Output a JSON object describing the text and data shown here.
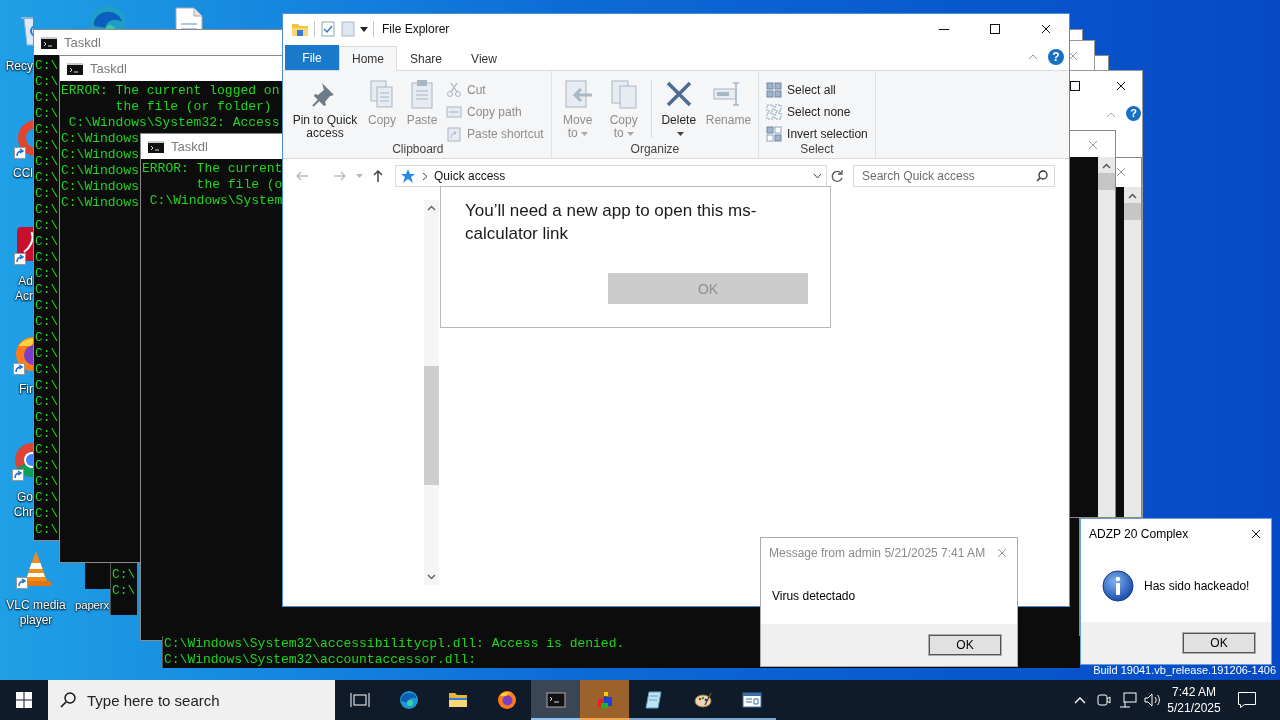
{
  "desktop_icons": [
    {
      "kind": "recycle-bin",
      "label": "Recy"
    },
    {
      "kind": "swirl"
    },
    {
      "kind": "document"
    },
    {
      "kind": "ring",
      "shortcut": true,
      "label": "CCl"
    },
    {
      "kind": "app-tile",
      "shortcut": true,
      "label": "Ad Acr"
    },
    {
      "kind": "flame-globe",
      "shortcut": true,
      "label": "Fir"
    },
    {
      "kind": "wheel",
      "shortcut": true,
      "label": "Go Chr"
    },
    {
      "kind": "cone",
      "shortcut": true,
      "label": "VLC media player"
    },
    {
      "label": "paperx"
    }
  ],
  "consoles": [
    {
      "title": "Taskdl",
      "lines": [
        "C:\\",
        "C:\\",
        "C:\\",
        "C:\\",
        "C:\\",
        "C:\\",
        "C:\\",
        "C:\\",
        "C:\\",
        "C:\\",
        "C:\\",
        "C:\\",
        "C:\\",
        "C:\\",
        "C:\\",
        "C:\\",
        "C:\\",
        "C:\\",
        "C:\\",
        "C:\\",
        "C:\\",
        "C:\\",
        "C:\\",
        "C:\\",
        "C:\\",
        "C:\\",
        "C:\\",
        "C:\\",
        "C:\\",
        "C:\\"
      ]
    },
    {
      "title": "Taskdl",
      "lines": [
        "ERROR: The current logged on",
        "       the file (or folder)",
        " C:\\Windows\\System32: Access",
        "C:\\Windows",
        "C:\\Windows",
        "C:\\Windows",
        "C:\\Windows",
        "C:\\Windows"
      ]
    },
    {
      "lines": [
        "C:\\",
        "C:\\"
      ]
    },
    {
      "title": "Taskdl",
      "lines": [
        "ERROR: The current",
        "       the file (o",
        " C:\\Windows\\System"
      ]
    },
    {
      "lines": [
        "C:\\Windows\\System32\\accessibilitycpl.dll: Access is denied.",
        "C:\\Windows\\System32\\accountaccessor.dll:"
      ]
    }
  ],
  "side_window": {
    "help": "?"
  },
  "explorer": {
    "title": "File Explorer",
    "help": "?",
    "tabs": [
      {
        "label": "File",
        "kind": "menu",
        "selected": false
      },
      {
        "label": "Home",
        "kind": "tab",
        "selected": true
      },
      {
        "label": "Share",
        "kind": "tab",
        "selected": false
      },
      {
        "label": "View",
        "kind": "tab",
        "selected": false
      }
    ],
    "ribbon_groups": [
      {
        "label": "Clipboard",
        "buttons": [
          {
            "kind": "pin",
            "label": "Pin to Quick access",
            "disabled": false
          },
          {
            "kind": "copy",
            "label": "Copy",
            "disabled": true
          },
          {
            "kind": "paste",
            "label": "Paste",
            "disabled": true
          },
          {
            "kind": "cut",
            "label": "Cut",
            "disabled": true
          },
          {
            "kind": "copy-path",
            "label": "Copy path",
            "disabled": true
          },
          {
            "kind": "paste-shortcut",
            "label": "Paste shortcut",
            "disabled": true
          }
        ]
      },
      {
        "label": "Organize",
        "buttons": [
          {
            "kind": "move-to",
            "label": "Move to",
            "disabled": true,
            "dropdown": true
          },
          {
            "kind": "copy-to",
            "label": "Copy to",
            "disabled": true,
            "dropdown": true
          },
          {
            "kind": "delete",
            "label": "Delete",
            "disabled": false,
            "dropdown": true,
            "divider_before": true
          },
          {
            "kind": "rename",
            "label": "Rename",
            "disabled": true
          }
        ]
      },
      {
        "label": "Select",
        "buttons": [
          {
            "kind": "select-all",
            "label": "Select all",
            "disabled": false
          },
          {
            "kind": "select-none",
            "label": "Select none",
            "disabled": false
          },
          {
            "kind": "invert-selection",
            "label": "Invert selection",
            "disabled": false
          }
        ]
      }
    ],
    "address": {
      "path": "Quick access",
      "search_placeholder": "Search Quick access"
    },
    "dialog": {
      "message": "You’ll need a new app to open this ms-calculator link",
      "button": "OK",
      "disabled": true
    }
  },
  "messages": [
    {
      "kind": "plain",
      "title": "Message from admin 5/21/2025 7:41 AM",
      "text": "Virus detectado",
      "button": "OK",
      "active": false
    },
    {
      "kind": "info",
      "title": "ADZP 20 Complex",
      "text": "Has sido hackeado!",
      "button": "OK",
      "active": true
    }
  ],
  "build_text": "Build 19041.vb_release.191206-1406",
  "taskbar": {
    "search_placeholder": "Type here to search",
    "apps": [
      {
        "kind": "task-view",
        "selected": false,
        "running": false,
        "attention": false
      },
      {
        "kind": "swirl",
        "selected": false,
        "running": false,
        "attention": false
      },
      {
        "kind": "folder",
        "selected": false,
        "running": false,
        "attention": false
      },
      {
        "kind": "flame-globe",
        "selected": false,
        "running": false,
        "attention": false
      },
      {
        "kind": "terminal",
        "selected": true,
        "running": true,
        "attention": false
      },
      {
        "kind": "cube",
        "selected": false,
        "running": true,
        "attention": true
      },
      {
        "kind": "notebook",
        "selected": false,
        "running": true,
        "attention": false
      },
      {
        "kind": "palette",
        "selected": false,
        "running": true,
        "attention": false
      },
      {
        "kind": "window",
        "selected": false,
        "running": true,
        "attention": false
      }
    ],
    "time": "7:42 AM",
    "date": "5/21/2025"
  }
}
